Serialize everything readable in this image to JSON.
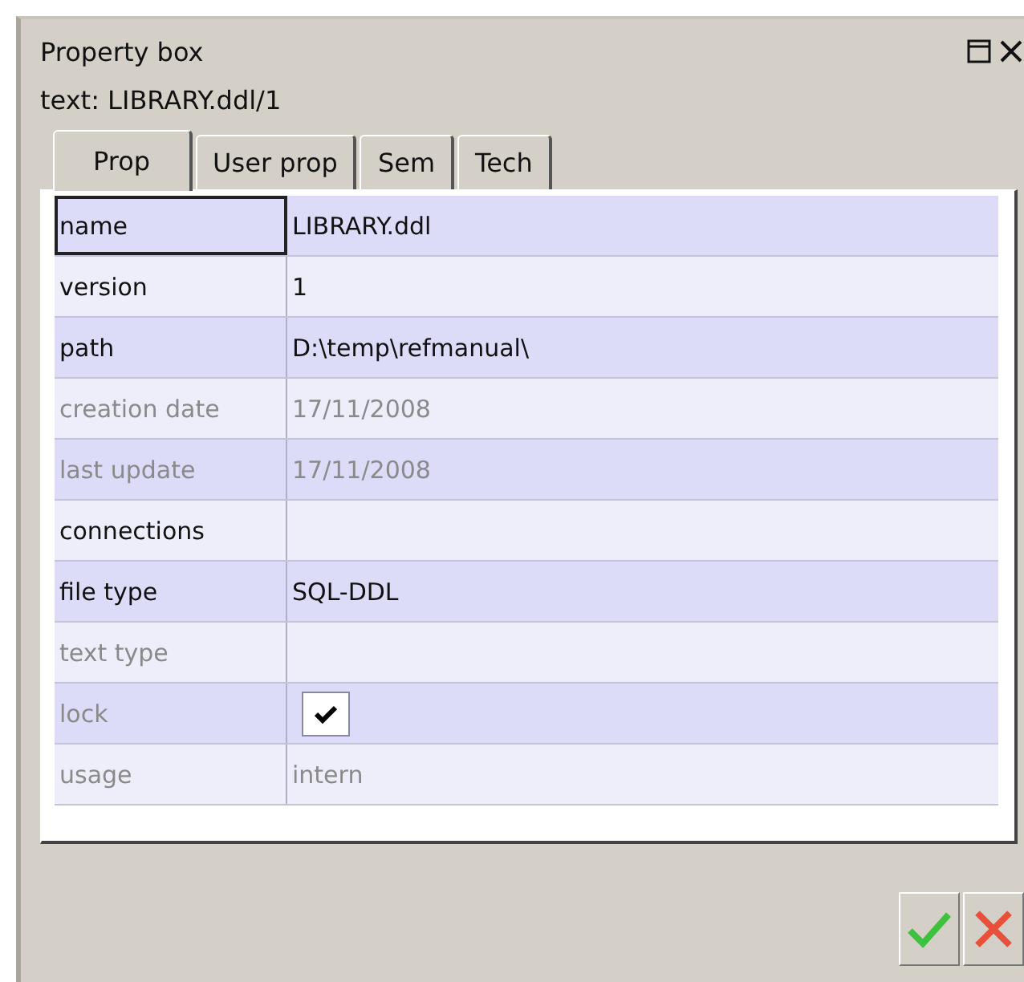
{
  "window": {
    "title": "Property box",
    "subtitle": "text: LIBRARY.ddl/1"
  },
  "tabs": [
    {
      "label": "Prop",
      "selected": true
    },
    {
      "label": "User prop",
      "selected": false
    },
    {
      "label": "Sem",
      "selected": false
    },
    {
      "label": "Tech",
      "selected": false
    }
  ],
  "properties": [
    {
      "kind": "text",
      "name": "name",
      "value": "LIBRARY.ddl",
      "disabled": false,
      "selected": true
    },
    {
      "kind": "text",
      "name": "version",
      "value": "1",
      "disabled": false,
      "selected": false
    },
    {
      "kind": "text",
      "name": "path",
      "value": "D:\\temp\\refmanual\\",
      "disabled": false,
      "selected": false
    },
    {
      "kind": "text",
      "name": "creation date",
      "value": "17/11/2008",
      "disabled": true,
      "selected": false
    },
    {
      "kind": "text",
      "name": "last update",
      "value": "17/11/2008",
      "disabled": true,
      "selected": false
    },
    {
      "kind": "text",
      "name": "connections",
      "disabled": false,
      "selected": false
    },
    {
      "kind": "text",
      "name": "file type",
      "value": "SQL-DDL",
      "disabled": false,
      "selected": false
    },
    {
      "kind": "text",
      "name": "text type",
      "disabled": true,
      "selected": false
    },
    {
      "kind": "checkbox",
      "name": "lock",
      "checked": true,
      "disabled": true,
      "selected": false
    },
    {
      "kind": "text",
      "name": "usage",
      "value": "intern",
      "disabled": true,
      "selected": false
    }
  ]
}
